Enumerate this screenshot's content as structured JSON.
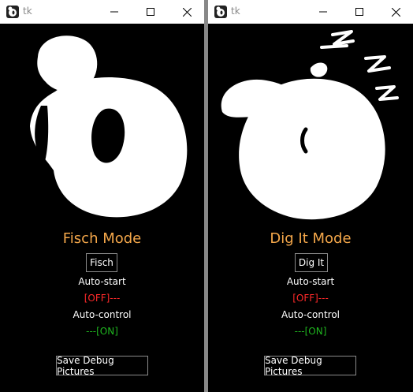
{
  "windows": [
    {
      "title": "tk",
      "mode_title": "Fisch Mode",
      "mode_button": "Fisch",
      "auto_start_label": "Auto-start",
      "auto_start_status": "[OFF]---",
      "auto_control_label": "Auto-control",
      "auto_control_status": "---[ON]",
      "save_button": "Save Debug Pictures",
      "art": "fisch-mascot-awake"
    },
    {
      "title": "tk",
      "mode_title": "Dig It Mode",
      "mode_button": "Dig It",
      "auto_start_label": "Auto-start",
      "auto_start_status": "[OFF]---",
      "auto_control_label": "Auto-control",
      "auto_control_status": "---[ON]",
      "save_button": "Save Debug Pictures",
      "art": "dig-it-mascot-sleeping"
    }
  ],
  "colors": {
    "mode_title": "#f4a74a",
    "status_off": "#ff2a2a",
    "status_on": "#1fb51f",
    "window_bg": "#000000",
    "titlebar_bg": "#ffffff"
  }
}
